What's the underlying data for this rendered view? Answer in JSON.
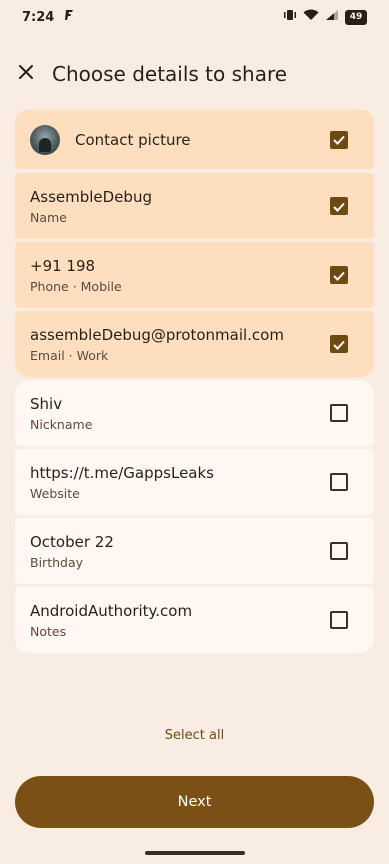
{
  "status_bar": {
    "time": "7:24",
    "battery": "49"
  },
  "header": {
    "title": "Choose details to share"
  },
  "items": [
    {
      "primary": "Contact picture",
      "secondary": "",
      "checked": true
    },
    {
      "primary": "AssembleDebug",
      "secondary": "Name",
      "checked": true
    },
    {
      "primary": "+91 198",
      "secondary": "Phone · Mobile",
      "checked": true
    },
    {
      "primary": "assembleDebug@protonmail.com",
      "secondary": "Email · Work",
      "checked": true
    },
    {
      "primary": "Shiv",
      "secondary": "Nickname",
      "checked": false
    },
    {
      "primary": "https://t.me/GappsLeaks",
      "secondary": "Website",
      "checked": false
    },
    {
      "primary": "October 22",
      "secondary": "Birthday",
      "checked": false
    },
    {
      "primary": "AndroidAuthority.com",
      "secondary": "Notes",
      "checked": false
    }
  ],
  "select_all_label": "Select all",
  "next_label": "Next",
  "colors": {
    "background": "#f8ece3",
    "checked_row": "#fddfbf",
    "unchecked_row": "#fff7f2",
    "accent": "#7a5017"
  }
}
